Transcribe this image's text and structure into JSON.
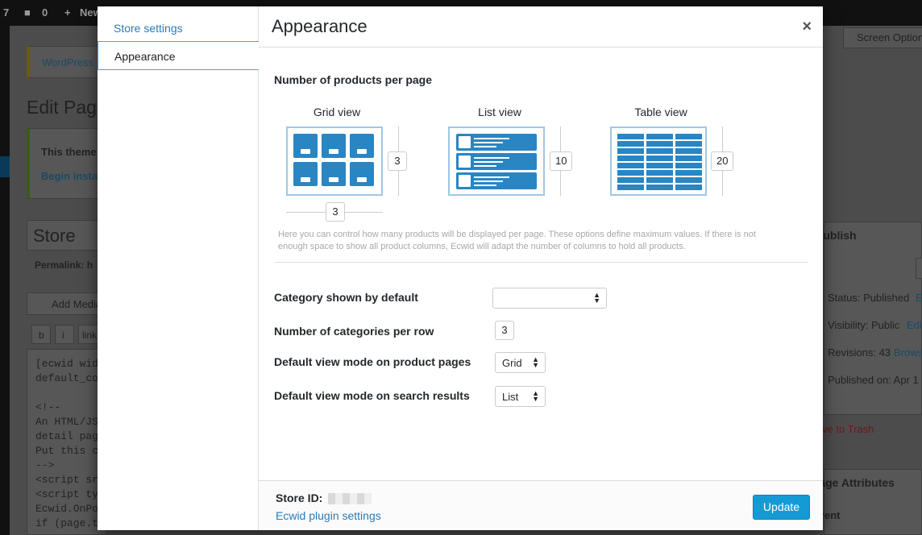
{
  "wp_admin": {
    "topbar": {
      "count": "7",
      "comments": "0",
      "new": "New"
    },
    "screen_options": "Screen Options",
    "notice_link": "WordPress",
    "page_heading": "Edit Page",
    "theme_notice": "This theme",
    "theme_link": "Begin insta",
    "post_title": "Store",
    "permalink": "Permalink: h",
    "add_media": "Add Media",
    "toolbar_b": "b",
    "toolbar_i": "i",
    "toolbar_link": "link",
    "code_lines": [
      "[ecwid wid",
      "default_co",
      "",
      "<!--",
      "An HTML/JS",
      "detail pag",
      "Put this c",
      "-->",
      "<script sr",
      "<script ty",
      "Ecwid.OnPo",
      "  if (page.type == \"PRODUCT\") {"
    ],
    "publish_title": "Publish",
    "status": "Status: Published",
    "edit": "Edit",
    "visibility": "Visibility: Public",
    "revisions": "Revisions: 43",
    "browse": "Browse",
    "published_on": "Published on: Apr 1",
    "move_to_trash": "Move to Trash",
    "page_attributes": "Page Attributes",
    "parent": "Parent"
  },
  "modal": {
    "nav": [
      "Store settings",
      "Appearance"
    ],
    "title": "Appearance",
    "close": "×",
    "section_products": "Number of products per page",
    "grid_label": "Grid view",
    "list_label": "List view",
    "table_label": "Table view",
    "grid_rows": "3",
    "grid_cols": "3",
    "list_count": "10",
    "table_count": "20",
    "help_text": "Here you can control how many products will be displayed per page. These options define maximum values. If there is not enough space to show all product columns, Ecwid will adapt the number of columns to hold all products.",
    "category_label": "Category shown by default",
    "category_value": "",
    "categories_per_row_label": "Number of categories per row",
    "categories_per_row": "3",
    "product_view_label": "Default view mode on product pages",
    "product_view_value": "Grid",
    "search_view_label": "Default view mode on search results",
    "search_view_value": "List",
    "store_id_label": "Store ID:",
    "plugin_settings_link": "Ecwid plugin settings",
    "update_button": "Update"
  },
  "colors": {
    "accent": "#2a85c3",
    "link": "#2a7bb8",
    "button": "#149bd6"
  }
}
